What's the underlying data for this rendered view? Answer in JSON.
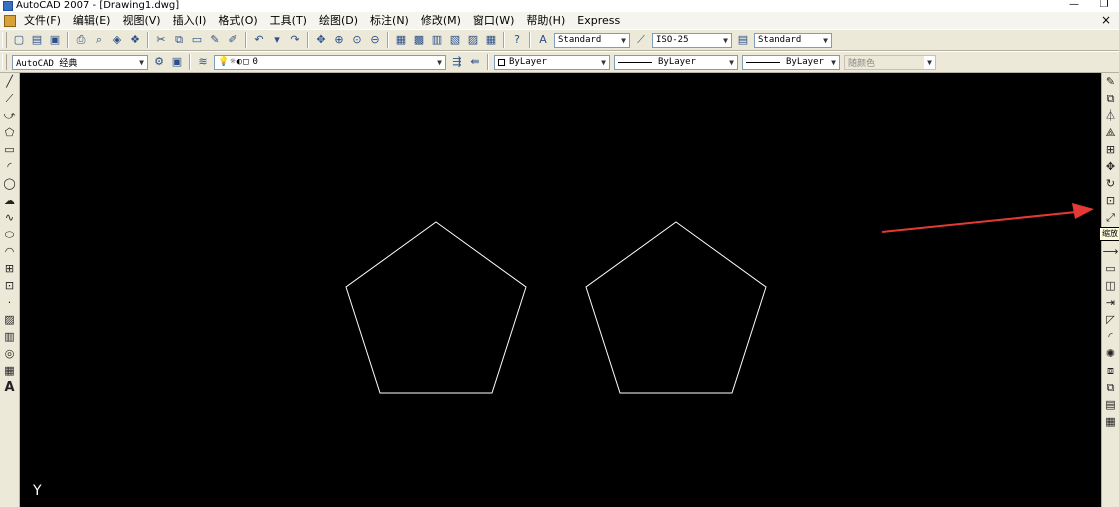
{
  "window": {
    "title": "AutoCAD 2007 - [Drawing1.dwg]",
    "minimize": "—",
    "restore": "❐"
  },
  "menu": {
    "items": [
      "文件(F)",
      "编辑(E)",
      "视图(V)",
      "插入(I)",
      "格式(O)",
      "工具(T)",
      "绘图(D)",
      "标注(N)",
      "修改(M)",
      "窗口(W)",
      "帮助(H)",
      "Express"
    ],
    "close": "×"
  },
  "toolbar1": {
    "text_style": "Standard",
    "dim_style": "ISO-25",
    "table_style": "Standard"
  },
  "toolbar2": {
    "workspace": "AutoCAD 经典",
    "layer": "0",
    "color": "ByLayer",
    "linetype": "ByLayer",
    "lineweight": "ByLayer",
    "plot_style": "随颜色"
  },
  "canvas": {
    "y_axis_label": "Y",
    "background": "#000000",
    "stroke_color": "#ffffff"
  },
  "tooltip": {
    "text": "缩放"
  },
  "annotation": {
    "arrow_color": "#e53935"
  },
  "icons": {
    "left_tools": [
      "line-icon",
      "construction-line-icon",
      "polyline-icon",
      "polygon-icon",
      "rectangle-icon",
      "arc-icon",
      "circle-icon",
      "revision-cloud-icon",
      "spline-icon",
      "ellipse-icon",
      "ellipse-arc-icon",
      "insert-block-icon",
      "make-block-icon",
      "point-icon",
      "hatch-icon",
      "gradient-icon",
      "region-icon",
      "table-icon",
      "multiline-text-icon"
    ],
    "right_tools": [
      "erase-icon",
      "copy-icon",
      "mirror-icon",
      "offset-icon",
      "array-icon",
      "move-icon",
      "rotate-icon",
      "scale-icon",
      "stretch-icon",
      "trim-icon",
      "extend-icon",
      "break-at-point-icon",
      "break-icon",
      "join-icon",
      "chamfer-icon",
      "fillet-icon",
      "explode-icon",
      "draworder-icon",
      "bring-front-icon",
      "send-back-icon",
      "properties-icon"
    ]
  }
}
